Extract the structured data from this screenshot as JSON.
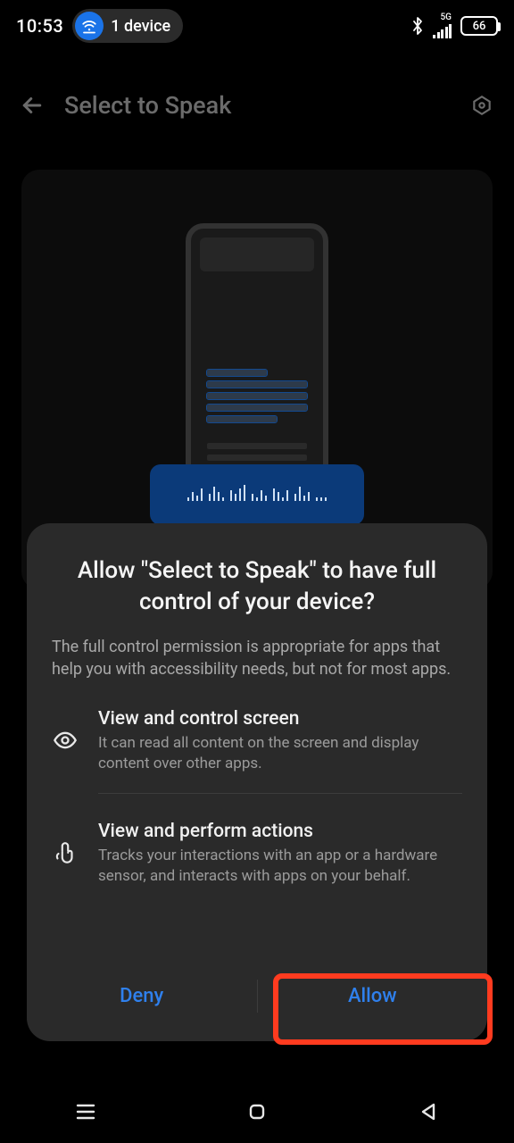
{
  "status": {
    "time": "10:53",
    "cast_device_count": "1 device",
    "network_label": "5G",
    "battery_text": "66"
  },
  "header": {
    "title": "Select to Speak"
  },
  "sheet": {
    "title": "Allow \"Select to Speak\" to have full control of your device?",
    "subtitle": "The full control permission is appropriate for apps that help you with accessibility needs, but not for most apps.",
    "perm1_title": "View and control screen",
    "perm1_desc": "It can read all content on the screen and display content over other apps.",
    "perm2_title": "View and perform actions",
    "perm2_desc": "Tracks your interactions with an app or a hardware sensor, and interacts with apps on your behalf.",
    "deny_label": "Deny",
    "allow_label": "Allow"
  }
}
